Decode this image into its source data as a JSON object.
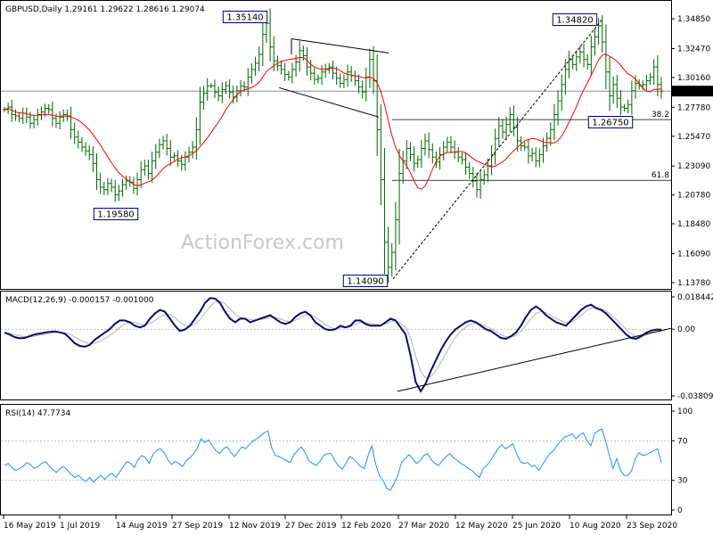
{
  "chart_data": [
    {
      "panel": "price",
      "type": "ohlc-bar",
      "title": "GBPUSD,Daily  1.29161 1.29622 1.28616 1.29074",
      "ylim": [
        1.1378,
        1.3585
      ],
      "y_ticks": [
        1.3485,
        1.3247,
        1.3016,
        1.2778,
        1.2547,
        1.2309,
        1.2078,
        1.1848,
        1.1609,
        1.1378
      ],
      "tick_labels": [
        "1.34850",
        "1.32470",
        "1.30160",
        "1.27780",
        "1.25470",
        "1.23090",
        "1.20780",
        "1.18480",
        "1.16090",
        "1.13780"
      ],
      "x_labels": [
        "16 May 2019",
        "1 Jul 2019",
        "14 Aug 2019",
        "27 Sep 2019",
        "12 Nov 2019",
        "27 Dec 2019",
        "12 Feb 2020",
        "27 Mar 2020",
        "12 May 2020",
        "25 Jun 2020",
        "10 Aug 2020",
        "23 Sep 2020"
      ],
      "current_price": {
        "value": 1.29074,
        "label": "1.29074"
      },
      "close": [
        1.276,
        1.278,
        1.272,
        1.271,
        1.269,
        1.273,
        1.27,
        1.265,
        1.268,
        1.272,
        1.274,
        1.277,
        1.276,
        1.269,
        1.265,
        1.27,
        1.272,
        1.271,
        1.26,
        1.254,
        1.25,
        1.246,
        1.243,
        1.24,
        1.233,
        1.22,
        1.214,
        1.212,
        1.217,
        1.214,
        1.208,
        1.211,
        1.216,
        1.219,
        1.218,
        1.213,
        1.22,
        1.228,
        1.231,
        1.225,
        1.235,
        1.242,
        1.248,
        1.251,
        1.245,
        1.238,
        1.239,
        1.235,
        1.232,
        1.238,
        1.242,
        1.246,
        1.26,
        1.282,
        1.289,
        1.295,
        1.295,
        1.29,
        1.287,
        1.292,
        1.295,
        1.29,
        1.286,
        1.291,
        1.295,
        1.294,
        1.302,
        1.308,
        1.313,
        1.32,
        1.336,
        1.345,
        1.326,
        1.315,
        1.311,
        1.308,
        1.304,
        1.302,
        1.308,
        1.314,
        1.323,
        1.319,
        1.31,
        1.305,
        1.3,
        1.301,
        1.306,
        1.308,
        1.31,
        1.305,
        1.301,
        1.297,
        1.3,
        1.306,
        1.303,
        1.299,
        1.294,
        1.29,
        1.302,
        1.316,
        1.299,
        1.26,
        1.22,
        1.17,
        1.15,
        1.162,
        1.188,
        1.225,
        1.235,
        1.245,
        1.24,
        1.233,
        1.236,
        1.245,
        1.251,
        1.244,
        1.238,
        1.234,
        1.24,
        1.246,
        1.25,
        1.246,
        1.242,
        1.238,
        1.236,
        1.23,
        1.225,
        1.219,
        1.212,
        1.22,
        1.224,
        1.231,
        1.24,
        1.253,
        1.263,
        1.258,
        1.264,
        1.272,
        1.262,
        1.251,
        1.247,
        1.246,
        1.239,
        1.241,
        1.235,
        1.24,
        1.247,
        1.253,
        1.26,
        1.272,
        1.283,
        1.296,
        1.308,
        1.316,
        1.312,
        1.318,
        1.322,
        1.316,
        1.312,
        1.326,
        1.334,
        1.343,
        1.33,
        1.306,
        1.287,
        1.296,
        1.285,
        1.278,
        1.277,
        1.28,
        1.291,
        1.297,
        1.295,
        1.296,
        1.299,
        1.302,
        1.31,
        1.296,
        1.2907
      ]
    },
    {
      "panel": "macd",
      "type": "line",
      "title": "MACD(12,26,9) -0.000157 -0.001000",
      "ylim": [
        -0.038095,
        0.018442
      ],
      "tick_labels": [
        "0.018442",
        "0.00",
        "-0.038095"
      ],
      "macd": [
        -0.002,
        -0.003,
        -0.0045,
        -0.0052,
        -0.005,
        -0.004,
        -0.003,
        -0.0025,
        -0.002,
        -0.0015,
        -0.0012,
        -0.0018,
        -0.0025,
        -0.005,
        -0.008,
        -0.0095,
        -0.01,
        -0.009,
        -0.006,
        -0.004,
        -0.002,
        0.0,
        0.003,
        0.005,
        0.005,
        0.004,
        0.002,
        0.001,
        0.002,
        0.006,
        0.009,
        0.011,
        0.01,
        0.006,
        0.002,
        -0.001,
        -0.0002,
        0.002,
        0.006,
        0.01,
        0.015,
        0.0178,
        0.0175,
        0.015,
        0.01,
        0.006,
        0.004,
        0.006,
        0.006,
        0.004,
        0.005,
        0.006,
        0.007,
        0.008,
        0.006,
        0.004,
        0.003,
        0.004,
        0.007,
        0.009,
        0.01,
        0.008,
        0.004,
        0.002,
        0.0,
        -0.0005,
        0.0,
        0.002,
        0.001,
        0.002,
        0.005,
        0.005,
        0.003,
        0.002,
        0.002,
        0.002,
        0.004,
        0.006,
        0.005,
        0.001,
        -0.003,
        -0.015,
        -0.03,
        -0.0355,
        -0.031,
        -0.024,
        -0.018,
        -0.012,
        -0.007,
        -0.003,
        0.0,
        0.002,
        0.004,
        0.005,
        0.004,
        0.002,
        0.0,
        -0.001,
        -0.003,
        -0.005,
        -0.0055,
        -0.004,
        -0.002,
        0.002,
        0.007,
        0.011,
        0.013,
        0.011,
        0.008,
        0.006,
        0.004,
        0.003,
        0.002,
        0.005,
        0.008,
        0.011,
        0.013,
        0.014,
        0.012,
        0.011,
        0.009,
        0.006,
        0.003,
        0.0,
        -0.003,
        -0.005,
        -0.0055,
        -0.004,
        -0.002,
        -0.0008,
        -0.0002,
        -0.0002
      ],
      "signal": [
        -0.002,
        -0.0023,
        -0.003,
        -0.0038,
        -0.0043,
        -0.0044,
        -0.004,
        -0.0034,
        -0.003,
        -0.0025,
        -0.002,
        -0.0018,
        -0.002,
        -0.0028,
        -0.0045,
        -0.006,
        -0.0075,
        -0.0085,
        -0.008,
        -0.007,
        -0.0055,
        -0.0035,
        -0.0015,
        0.001,
        0.003,
        0.004,
        0.0038,
        0.003,
        0.0025,
        0.0032,
        0.005,
        0.007,
        0.0085,
        0.0085,
        0.0068,
        0.004,
        0.0022,
        0.0018,
        0.003,
        0.0055,
        0.009,
        0.013,
        0.0155,
        0.016,
        0.0145,
        0.0115,
        0.0085,
        0.0068,
        0.006,
        0.0055,
        0.0052,
        0.0055,
        0.006,
        0.0068,
        0.0068,
        0.006,
        0.0048,
        0.0042,
        0.005,
        0.0066,
        0.0082,
        0.0085,
        0.007,
        0.0048,
        0.0026,
        0.001,
        0.0002,
        0.0008,
        0.001,
        0.0014,
        0.0028,
        0.004,
        0.0038,
        0.0032,
        0.0028,
        0.0024,
        0.003,
        0.0044,
        0.005,
        0.0035,
        0.001,
        -0.005,
        -0.015,
        -0.024,
        -0.028,
        -0.027,
        -0.024,
        -0.019,
        -0.014,
        -0.009,
        -0.0045,
        -0.0012,
        0.0012,
        0.003,
        0.0036,
        0.003,
        0.0016,
        0.0004,
        -0.0012,
        -0.003,
        -0.0044,
        -0.0046,
        -0.0036,
        -0.0012,
        0.0022,
        0.006,
        0.009,
        0.0102,
        0.0095,
        0.008,
        0.0062,
        0.0048,
        0.0036,
        0.004,
        0.0056,
        0.008,
        0.0104,
        0.0122,
        0.0124,
        0.0118,
        0.0104,
        0.0082,
        0.0056,
        0.0028,
        -0.0002,
        -0.0026,
        -0.0042,
        -0.0044,
        -0.0034,
        -0.002,
        -0.0012,
        -0.001
      ]
    },
    {
      "panel": "rsi",
      "type": "line",
      "title": "RSI(14) 47.7734",
      "ylim": [
        0,
        100
      ],
      "tick_labels": [
        "100",
        "70",
        "30",
        "0"
      ],
      "values": [
        45,
        47,
        43,
        40,
        42,
        44,
        48,
        46,
        42,
        44,
        47,
        49,
        45,
        41,
        38,
        42,
        44,
        40,
        36,
        33,
        35,
        31,
        29,
        33,
        28,
        32,
        35,
        31,
        35,
        37,
        33,
        38,
        44,
        49,
        47,
        43,
        51,
        55,
        53,
        47,
        56,
        60,
        62,
        58,
        51,
        46,
        49,
        47,
        44,
        50,
        53,
        57,
        63,
        72,
        68,
        71,
        65,
        60,
        57,
        62,
        64,
        58,
        54,
        59,
        64,
        62,
        66,
        70,
        72,
        75,
        78,
        80,
        63,
        55,
        54,
        52,
        50,
        48,
        56,
        60,
        64,
        58,
        50,
        47,
        45,
        49,
        55,
        57,
        57,
        50,
        45,
        41,
        47,
        54,
        52,
        48,
        44,
        42,
        55,
        65,
        47,
        35,
        30,
        22,
        20,
        27,
        35,
        48,
        52,
        56,
        52,
        47,
        50,
        55,
        57,
        51,
        47,
        45,
        50,
        54,
        57,
        53,
        50,
        47,
        45,
        42,
        40,
        36,
        33,
        42,
        45,
        50,
        56,
        62,
        66,
        62,
        64,
        67,
        57,
        49,
        47,
        48,
        44,
        45,
        40,
        46,
        52,
        57,
        60,
        66,
        70,
        74,
        75,
        77,
        72,
        76,
        78,
        70,
        65,
        77,
        80,
        82,
        70,
        55,
        42,
        52,
        40,
        35,
        35,
        40,
        52,
        58,
        55,
        56,
        58,
        60,
        62,
        48
      ]
    }
  ],
  "annotations": {
    "high_2019": "1.35140",
    "low_2019": "1.19580",
    "low_2020": "1.14090",
    "high_2020": "1.34820",
    "support": "1.26750",
    "fib_382": "38.2",
    "fib_618": "61.8"
  },
  "watermark": "ActionForex.com",
  "colors": {
    "price_bar": "#006400",
    "moving_average": "#ff0000",
    "macd_line": "#0a0a6e",
    "signal_line": "#b4b4b4",
    "rsi_line": "#1e90ff",
    "trendline": "#000000",
    "reference_line": "#808080",
    "tag_border": "#000080"
  }
}
